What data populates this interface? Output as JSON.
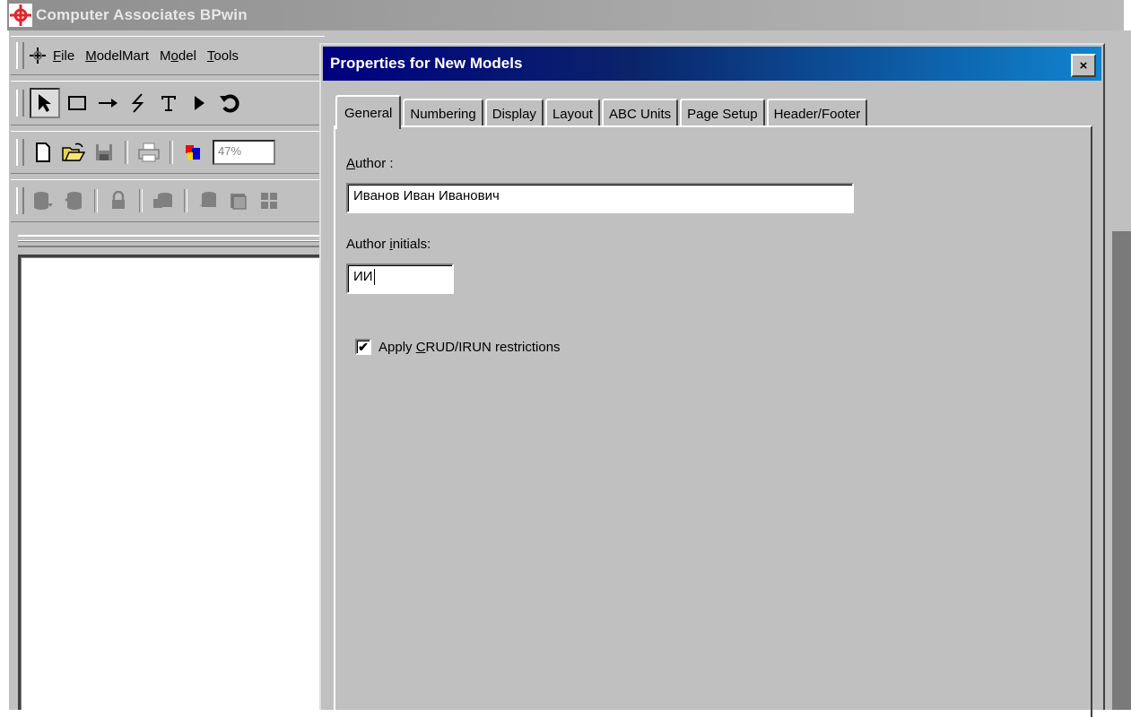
{
  "app": {
    "title": "Computer Associates BPwin"
  },
  "menu": [
    {
      "label": "File"
    },
    {
      "label": "ModelMart"
    },
    {
      "label": "Model"
    },
    {
      "label": "Tools"
    }
  ],
  "toolbar": {
    "zoom_value": "47%"
  },
  "icons": {
    "app_logo": "bpwin-logo-icon",
    "menu_logo": "bpwin-small-icon",
    "tools": [
      "pointer-icon",
      "box-icon",
      "arrow-icon",
      "squiggle-icon",
      "text-icon",
      "triangle-icon",
      "undo-icon"
    ],
    "standard": [
      "new-icon",
      "open-icon",
      "save-icon",
      "print-icon",
      "color-icon"
    ],
    "modelmart": [
      "mm-connect-icon",
      "mm-disconnect-icon",
      "mm-lock-icon",
      "mm-shelf-icon",
      "mm-report-icon",
      "mm-library-icon",
      "mm-grid-icon"
    ]
  },
  "dialog": {
    "title": "Properties for New Models",
    "close_glyph": "×",
    "tabs": [
      {
        "label": "General",
        "active": true
      },
      {
        "label": "Numbering",
        "active": false
      },
      {
        "label": "Display",
        "active": false
      },
      {
        "label": "Layout",
        "active": false
      },
      {
        "label": "ABC Units",
        "active": false
      },
      {
        "label": "Page Setup",
        "active": false
      },
      {
        "label": "Header/Footer",
        "active": false
      }
    ],
    "general": {
      "author_label": "Author :",
      "author_value": "Иванов Иван Иванович",
      "initials_label": "Author initials:",
      "initials_value": "ИИ",
      "crud_label": "Apply CRUD/IRUN restrictions",
      "crud_checked": true,
      "check_glyph": "✔"
    }
  }
}
